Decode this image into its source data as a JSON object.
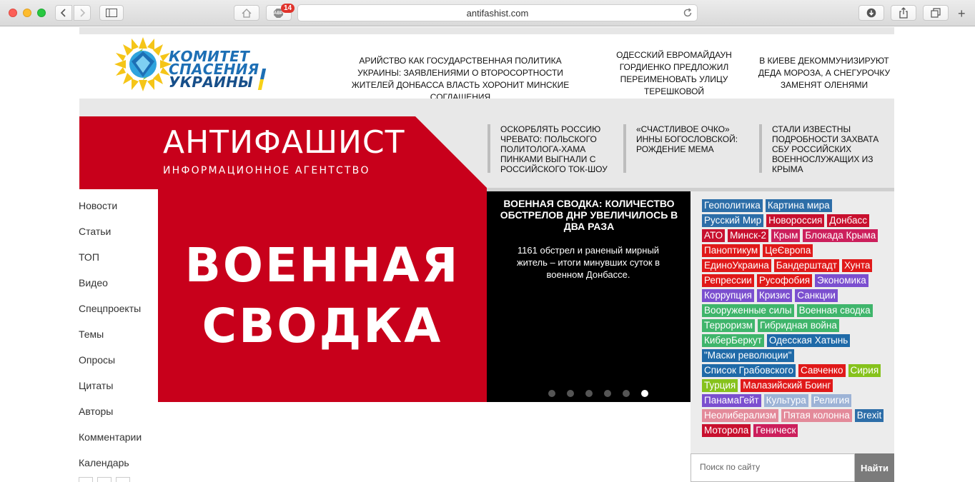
{
  "browser": {
    "url": "antifashist.com",
    "adblock_label": "ABP",
    "adblock_badge": "14",
    "new_tab": "+"
  },
  "header": {
    "logo": {
      "line1": "КОМИТЕТ",
      "line2": "СПАСЕНИЯ",
      "line3": "УКРАИНЫ"
    },
    "top_news": [
      {
        "text": "АРИЙСТВО КАК ГОСУДАРСТВЕННАЯ ПОЛИТИКА УКРАИНЫ: ЗАЯВЛЕНИЯМИ О ВТОРОСОРТНОСТИ ЖИТЕЛЕЙ ДОНБАССА ВЛАСТЬ ХОРОНИТ МИНСКИЕ СОГЛАШЕНИЯ"
      },
      {
        "text": "ОДЕССКИЙ ЕВРОМАЙДАУН ГОРДИЕНКО ПРЕДЛОЖИЛ ПЕРЕИМЕНОВАТЬ УЛИЦУ ТЕРЕШКОВОЙ"
      },
      {
        "text": "В КИЕВЕ ДЕКОММУНИЗИРУЮТ ДЕДА МОРОЗА, А СНЕГУРОЧКУ ЗАМЕНЯТ ОЛЕНЯМИ"
      }
    ]
  },
  "brand": {
    "title": "АНТИФАШИСТ",
    "subtitle": "ИНФОРМАЦИОННОЕ АГЕНТСТВО"
  },
  "band_news": [
    {
      "text": "Оскорблять Россию чревато: польского политолога-хама пинками выгнали с российского ток-шоу"
    },
    {
      "text": "«Счастливое очко» Инны Богословской: рождение мема"
    },
    {
      "text": "Стали известны подробности захвата СБУ российских военнослужащих из Крыма"
    }
  ],
  "nav": {
    "items": [
      "Новости",
      "Статьи",
      "ТОП",
      "Видео",
      "Спецпроекты",
      "Темы",
      "Опросы",
      "Цитаты",
      "Авторы",
      "Комментарии",
      "Календарь"
    ]
  },
  "slider": {
    "image_line1": "ВОЕННАЯ",
    "image_line2": "СВОДКА",
    "title": "Военная сводка: количество обстрелов ДНР увеличилось в два раза",
    "description": "1161 обстрел и раненый мирный житель – итоги минувших суток в военном Донбассе.",
    "dots_total": 6,
    "active_dot": 6
  },
  "tags": [
    {
      "label": "Геополитика",
      "color": "#2d6ea8"
    },
    {
      "label": "Картина мира",
      "color": "#2d6ea8"
    },
    {
      "label": "Русский Мир",
      "color": "#2d6ea8"
    },
    {
      "label": "Новороссия",
      "color": "#c8102e"
    },
    {
      "label": "Донбасс",
      "color": "#c8102e"
    },
    {
      "label": "АТО",
      "color": "#c8102e"
    },
    {
      "label": "Минск-2",
      "color": "#c8102e"
    },
    {
      "label": "Крым",
      "color": "#cc1f5c"
    },
    {
      "label": "Блокада Крыма",
      "color": "#cc1f5c"
    },
    {
      "label": "Паноптикум",
      "color": "#e01919"
    },
    {
      "label": "ЦеЄвропа",
      "color": "#e01919"
    },
    {
      "label": "ЕдиноУкраина",
      "color": "#e01919"
    },
    {
      "label": "Бандерштадт",
      "color": "#e01919"
    },
    {
      "label": "Хунта",
      "color": "#e01919"
    },
    {
      "label": "Репрессии",
      "color": "#e01919"
    },
    {
      "label": "Русофобия",
      "color": "#e01919"
    },
    {
      "label": "Экономика",
      "color": "#7b4fcf"
    },
    {
      "label": "Коррупция",
      "color": "#7b4fcf"
    },
    {
      "label": "Кризис",
      "color": "#7b4fcf"
    },
    {
      "label": "Санкции",
      "color": "#7b4fcf"
    },
    {
      "label": "Вооруженные силы",
      "color": "#3fb56b"
    },
    {
      "label": "Военная сводка",
      "color": "#3fb56b"
    },
    {
      "label": "Терроризм",
      "color": "#3fb56b"
    },
    {
      "label": "Гибридная война",
      "color": "#3fb56b"
    },
    {
      "label": "КиберБеркут",
      "color": "#3fb56b"
    },
    {
      "label": "Одесская Хатынь",
      "color": "#1f6aa8"
    },
    {
      "label": "\"Маски революции\"",
      "color": "#1f6aa8"
    },
    {
      "label": "Список Грабовского",
      "color": "#1f6aa8"
    },
    {
      "label": "Савченко",
      "color": "#e01919"
    },
    {
      "label": "Сирия",
      "color": "#86c21c"
    },
    {
      "label": "Турция",
      "color": "#86c21c"
    },
    {
      "label": "Малазийский Боинг",
      "color": "#e01919"
    },
    {
      "label": "ПанамаГейт",
      "color": "#7b4fcf"
    },
    {
      "label": "Культура",
      "color": "#9db3d6"
    },
    {
      "label": "Религия",
      "color": "#9db3d6"
    },
    {
      "label": "Неолиберализм",
      "color": "#e38a9a"
    },
    {
      "label": "Пятая колонна",
      "color": "#e38a9a"
    },
    {
      "label": "Brexit",
      "color": "#2d6ea8"
    },
    {
      "label": "Моторола",
      "color": "#c8102e"
    },
    {
      "label": "Геническ",
      "color": "#cc1f5c"
    }
  ],
  "search": {
    "placeholder": "Поиск по сайту",
    "button": "Найти"
  }
}
